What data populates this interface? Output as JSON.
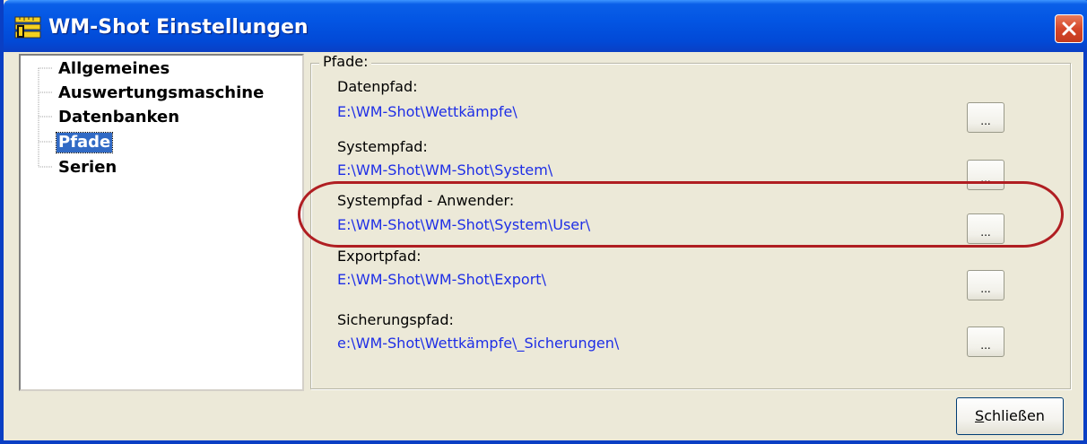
{
  "window": {
    "title": "WM-Shot Einstellungen",
    "title_icon": "ruler-app-icon",
    "close_icon": "close-icon"
  },
  "tree": {
    "items": [
      {
        "label": "Allgemeines",
        "selected": false
      },
      {
        "label": "Auswertungsmaschine",
        "selected": false
      },
      {
        "label": "Datenbanken",
        "selected": false
      },
      {
        "label": "Pfade",
        "selected": true
      },
      {
        "label": "Serien",
        "selected": false
      }
    ]
  },
  "paths": {
    "group_title": "Pfade:",
    "entries": [
      {
        "label": "Datenpfad:",
        "value": "E:\\WM-Shot\\Wettkämpfe\\",
        "button": "..."
      },
      {
        "label": "Systempfad:",
        "value": "E:\\WM-Shot\\WM-Shot\\System\\",
        "button": "..."
      },
      {
        "label": "Systempfad - Anwender:",
        "value": "E:\\WM-Shot\\WM-Shot\\System\\User\\",
        "button": "..."
      },
      {
        "label": "Exportpfad:",
        "value": "E:\\WM-Shot\\WM-Shot\\Export\\",
        "button": "..."
      },
      {
        "label": "Sicherungspfad:",
        "value": "e:\\WM-Shot\\Wettkämpfe\\_Sicherungen\\",
        "button": "..."
      }
    ]
  },
  "footer": {
    "close_label_mnemonic": "S",
    "close_label_rest": "chließen"
  },
  "colors": {
    "titlebar": "#0355e3",
    "path_value": "#1e2ee6",
    "highlight": "#b01e22",
    "selection": "#316ac5"
  }
}
